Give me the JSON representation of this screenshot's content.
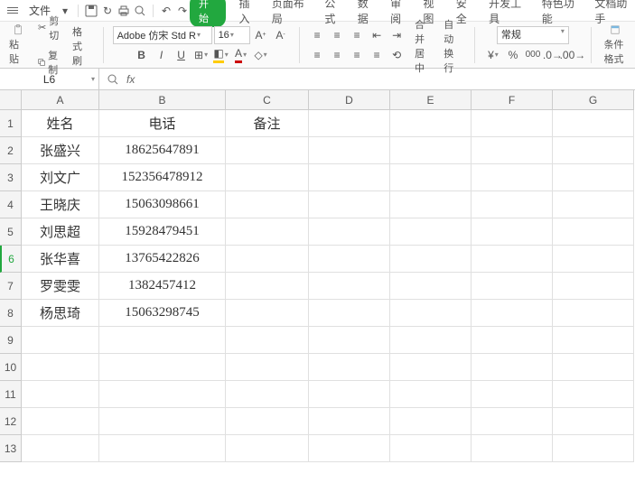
{
  "titlebar": {
    "file_menu": "文件"
  },
  "tabs": {
    "start": "开始",
    "insert": "插入",
    "layout": "页面布局",
    "formula": "公式",
    "data": "数据",
    "review": "审阅",
    "view": "视图",
    "security": "安全",
    "devtools": "开发工具",
    "special": "特色功能",
    "dochelper": "文档助手"
  },
  "ribbon": {
    "paste": "粘贴",
    "cut": "剪切",
    "copy": "复制",
    "format_painter": "格式刷",
    "font_name": "Adobe 仿宋 Std R",
    "font_size": "16",
    "merge_center": "合并居中",
    "wrap_text": "自动换行",
    "number_format": "常规",
    "cond_format": "条件格式"
  },
  "namebox": {
    "value": "L6"
  },
  "columns": [
    "A",
    "B",
    "C",
    "D",
    "E",
    "F",
    "G"
  ],
  "row_count": 13,
  "active_row": 6,
  "headers": {
    "name": "姓名",
    "phone": "电话",
    "note": "备注"
  },
  "data_rows": [
    {
      "name": "张盛兴",
      "phone": "18625647891"
    },
    {
      "name": "刘文广",
      "phone": "152356478912"
    },
    {
      "name": "王晓庆",
      "phone": "15063098661"
    },
    {
      "name": "刘思超",
      "phone": "15928479451"
    },
    {
      "name": "张华喜",
      "phone": "13765422826"
    },
    {
      "name": "罗雯雯",
      "phone": "1382457412"
    },
    {
      "name": "杨思琦",
      "phone": "15063298745"
    }
  ]
}
